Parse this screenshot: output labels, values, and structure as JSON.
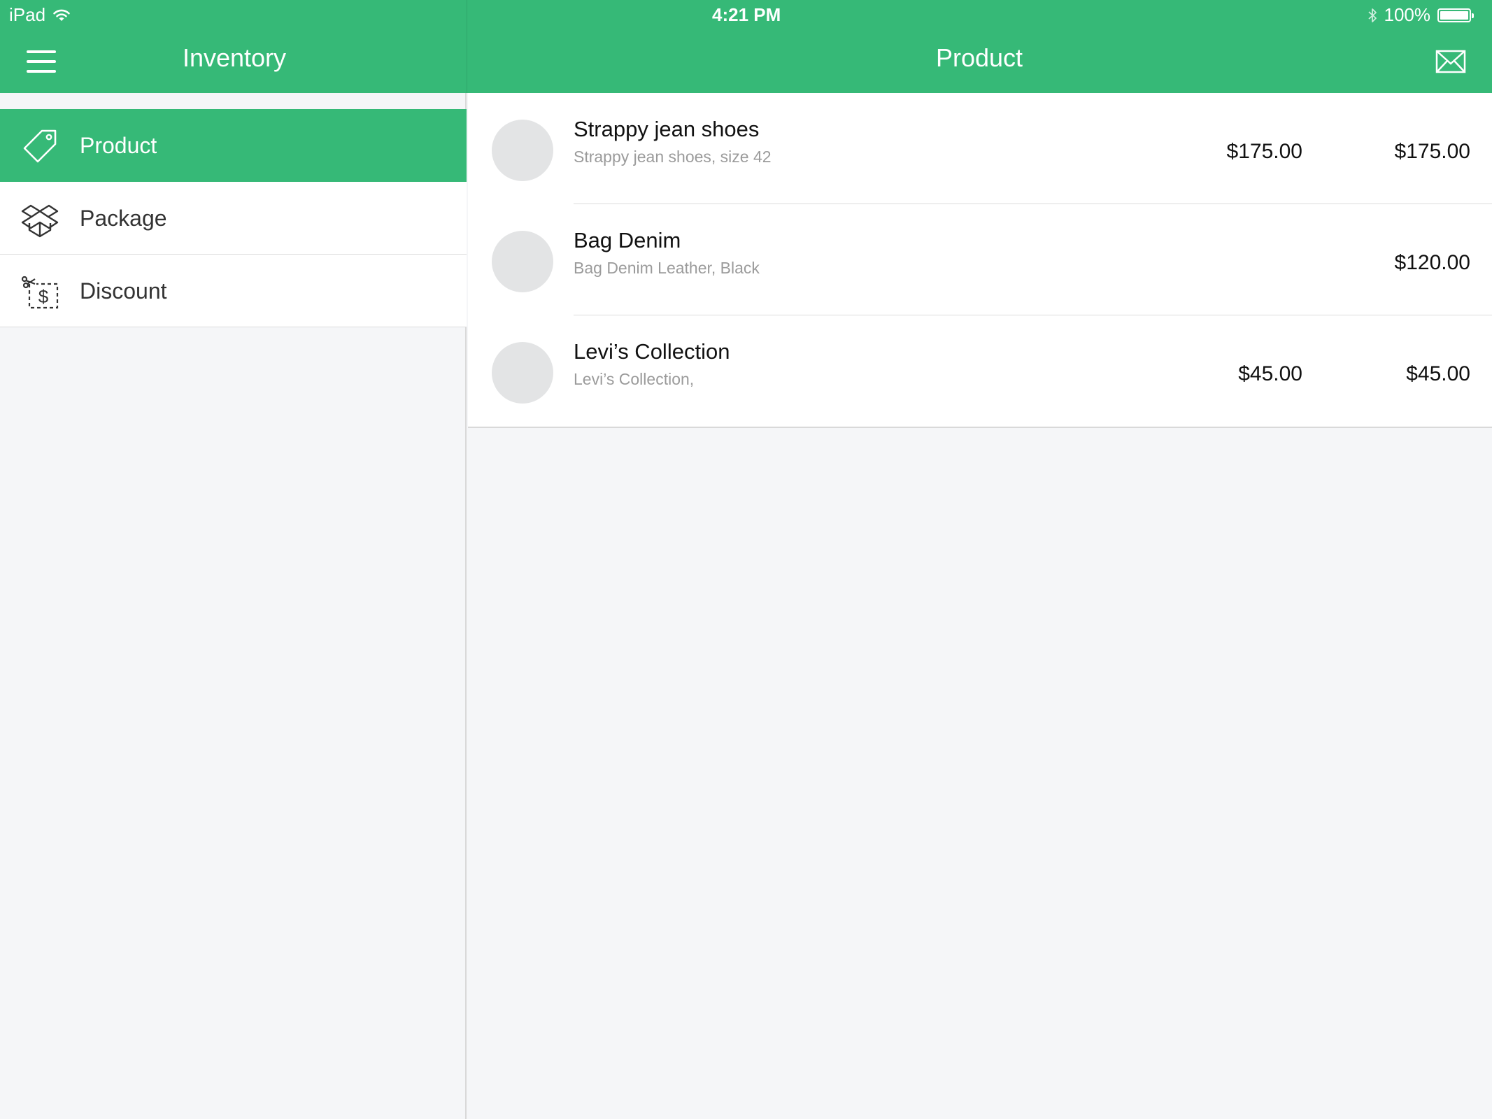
{
  "status_bar": {
    "device": "iPad",
    "time": "4:21 PM",
    "battery": "100%",
    "battery_level": 1.0
  },
  "header": {
    "left_title": "Inventory",
    "right_title": "Product",
    "menu_icon": "hamburger-menu-icon",
    "mail_icon": "mail-icon"
  },
  "colors": {
    "accent": "#36b977",
    "background": "#f5f6f8",
    "placeholder": "#e3e4e5"
  },
  "sidebar": {
    "items": [
      {
        "label": "Product",
        "icon": "tag-icon",
        "active": true
      },
      {
        "label": "Package",
        "icon": "box-icon",
        "active": false
      },
      {
        "label": "Discount",
        "icon": "coupon-icon",
        "active": false
      }
    ]
  },
  "products": [
    {
      "name": "Strappy jean shoes",
      "description": "Strappy jean shoes, size 42",
      "price1": "$175.00",
      "price2": "$175.00"
    },
    {
      "name": "Bag Denim",
      "description": "Bag Denim Leather, Black",
      "price1": "",
      "price2": "$120.00"
    },
    {
      "name": "Levi’s Collection",
      "description": "Levi’s Collection,",
      "price1": "$45.00",
      "price2": "$45.00"
    }
  ]
}
